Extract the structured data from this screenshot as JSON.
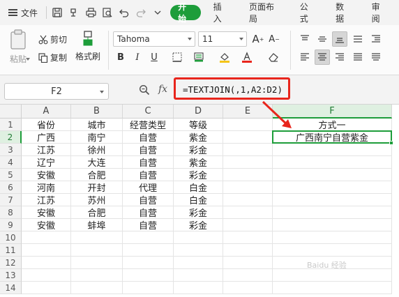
{
  "menubar": {
    "file_label": "文件",
    "tabs": [
      {
        "label": "开始",
        "active": true
      },
      {
        "label": "插入",
        "active": false
      },
      {
        "label": "页面布局",
        "active": false
      },
      {
        "label": "公式",
        "active": false
      },
      {
        "label": "数据",
        "active": false
      },
      {
        "label": "审阅",
        "active": false
      }
    ]
  },
  "ribbon": {
    "paste_label": "粘贴",
    "cut_label": "剪切",
    "copy_label": "复制",
    "format_painter_label": "格式刷",
    "font_name": "Tahoma",
    "font_size": "11",
    "font_color": "#e8251c",
    "fill_color": "#f5c518"
  },
  "formula_bar": {
    "name_box": "F2",
    "fx_label": "fx",
    "formula": "=TEXTJOIN(,1,A2:D2)"
  },
  "grid": {
    "columns": [
      "A",
      "B",
      "C",
      "D",
      "E",
      "F"
    ],
    "rows": [
      "1",
      "2",
      "3",
      "4",
      "5",
      "6",
      "7",
      "8",
      "9",
      "10",
      "11",
      "12",
      "13",
      "14"
    ],
    "data": [
      [
        "省份",
        "城市",
        "经营类型",
        "等级",
        "",
        "方式一"
      ],
      [
        "广西",
        "南宁",
        "自营",
        "紫金",
        "",
        "广西南宁自营紫金"
      ],
      [
        "江苏",
        "徐州",
        "自营",
        "彩金",
        "",
        ""
      ],
      [
        "辽宁",
        "大连",
        "自营",
        "紫金",
        "",
        ""
      ],
      [
        "安徽",
        "合肥",
        "自营",
        "彩金",
        "",
        ""
      ],
      [
        "河南",
        "开封",
        "代理",
        "白金",
        "",
        ""
      ],
      [
        "江苏",
        "苏州",
        "自营",
        "白金",
        "",
        ""
      ],
      [
        "安徽",
        "合肥",
        "自营",
        "彩金",
        "",
        ""
      ],
      [
        "安徽",
        "蚌埠",
        "自营",
        "彩金",
        "",
        ""
      ]
    ],
    "active_cell": "F2"
  },
  "colors": {
    "accent": "#1d9d3a",
    "annotation": "#e8251c"
  },
  "watermark": "Baidu 经验"
}
